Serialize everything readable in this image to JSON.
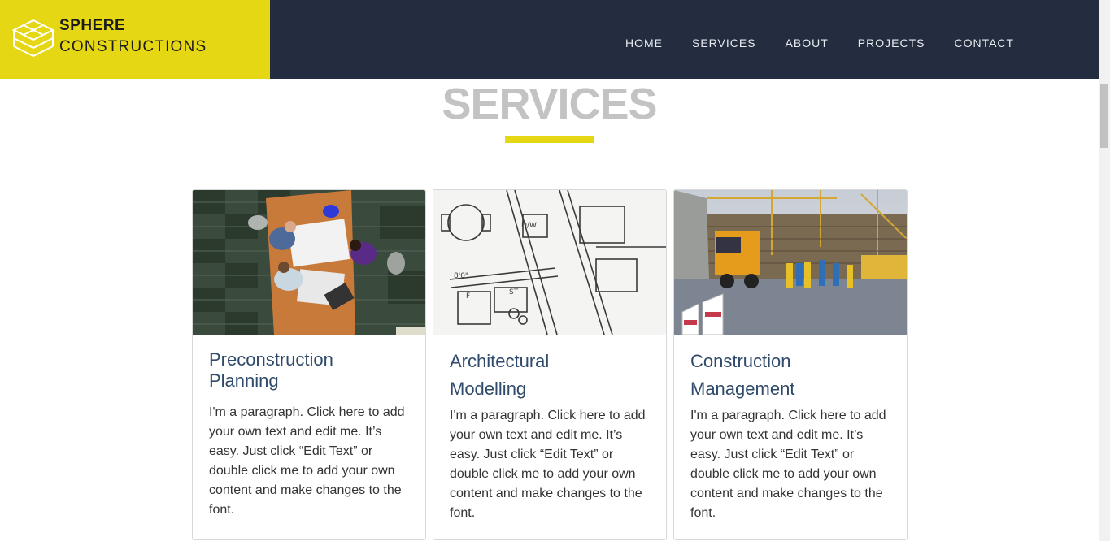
{
  "brand": {
    "name_line1": "SPHERE",
    "name_line2": "CONSTRUCTIONS",
    "accent_color": "#e6d714",
    "header_color": "#232d3f",
    "logo_icon": "stacked-layers-icon"
  },
  "nav": {
    "items": [
      {
        "label": "HOME"
      },
      {
        "label": "SERVICES"
      },
      {
        "label": "ABOUT"
      },
      {
        "label": "PROJECTS"
      },
      {
        "label": "CONTACT"
      }
    ]
  },
  "section": {
    "title": "SERVICES"
  },
  "cards": [
    {
      "title_line1": "Preconstruction",
      "title_line2": "Planning",
      "image": "meeting-table-photo",
      "text": "I'm a paragraph. Click here to add your own text and edit me. It’s easy. Just click “Edit Text” or double click me to add your own content and make changes to the font."
    },
    {
      "title_line1": "Architectural",
      "title_line2": "Modelling",
      "image": "blueprint-photo",
      "text": "I'm a paragraph. Click here to add your own text and edit me. It’s easy. Just click “Edit Text” or double click me to add your own content and make changes to the font."
    },
    {
      "title_line1": "Construction",
      "title_line2": "Management",
      "image": "construction-site-photo",
      "text": "I'm a paragraph. Click here to add your own text and edit me. It’s easy. Just click “Edit Text” or double click me to add your own content and make changes to the font."
    }
  ]
}
